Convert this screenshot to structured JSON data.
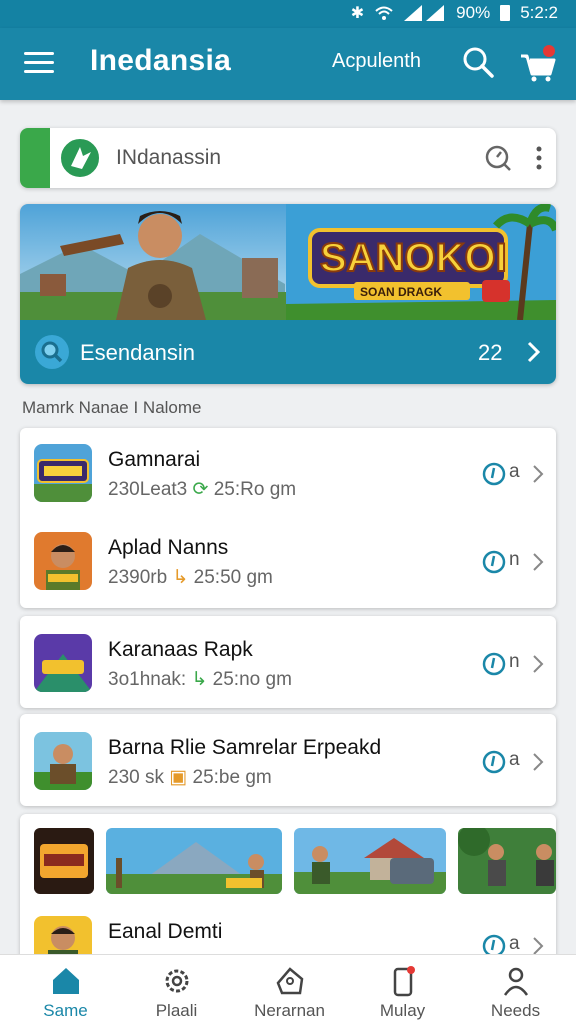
{
  "status_bar": {
    "battery": "90%",
    "time": "5:2:2"
  },
  "app_bar": {
    "title": "Inedansia",
    "subtitle": "Acpulenth"
  },
  "search_card": {
    "text": "INdanassin"
  },
  "banner": {
    "game_logo_text": "SANOKOI",
    "game_logo_sub": "SOAN DRAGK",
    "label": "Esendansin",
    "count": "22"
  },
  "section_title": "Mamrk Nanae I Nalome",
  "games": [
    {
      "name": "Gamnarai",
      "meta_left": "230Leat3",
      "meta_right": "25:Ro gm",
      "status_letter": "a"
    },
    {
      "name": "Aplad Nanns",
      "meta_left": "2390rb",
      "meta_right": "25:50 gm",
      "status_letter": "n"
    },
    {
      "name": "Karanaas Rapk",
      "meta_left": "3o1hnak:",
      "meta_right": "25:no gm",
      "status_letter": "n"
    },
    {
      "name": "Barna Rlie Samrelar Erpeakd",
      "meta_left": "230 sk",
      "meta_right": "25:be gm",
      "status_letter": "a"
    },
    {
      "name": "Eanal Demti",
      "meta_left": "",
      "meta_right": "",
      "status_letter": "a"
    }
  ],
  "bottom_nav": [
    {
      "label": "Same",
      "icon": "home-icon"
    },
    {
      "label": "Plaali",
      "icon": "settings-gear-icon"
    },
    {
      "label": "Nerarnan",
      "icon": "tag-icon"
    },
    {
      "label": "Mulay",
      "icon": "phone-icon"
    },
    {
      "label": "Needs",
      "icon": "person-icon"
    }
  ],
  "colors": {
    "primary": "#1a87a8",
    "accent_green": "#3aa84a",
    "badge_red": "#e53935"
  }
}
